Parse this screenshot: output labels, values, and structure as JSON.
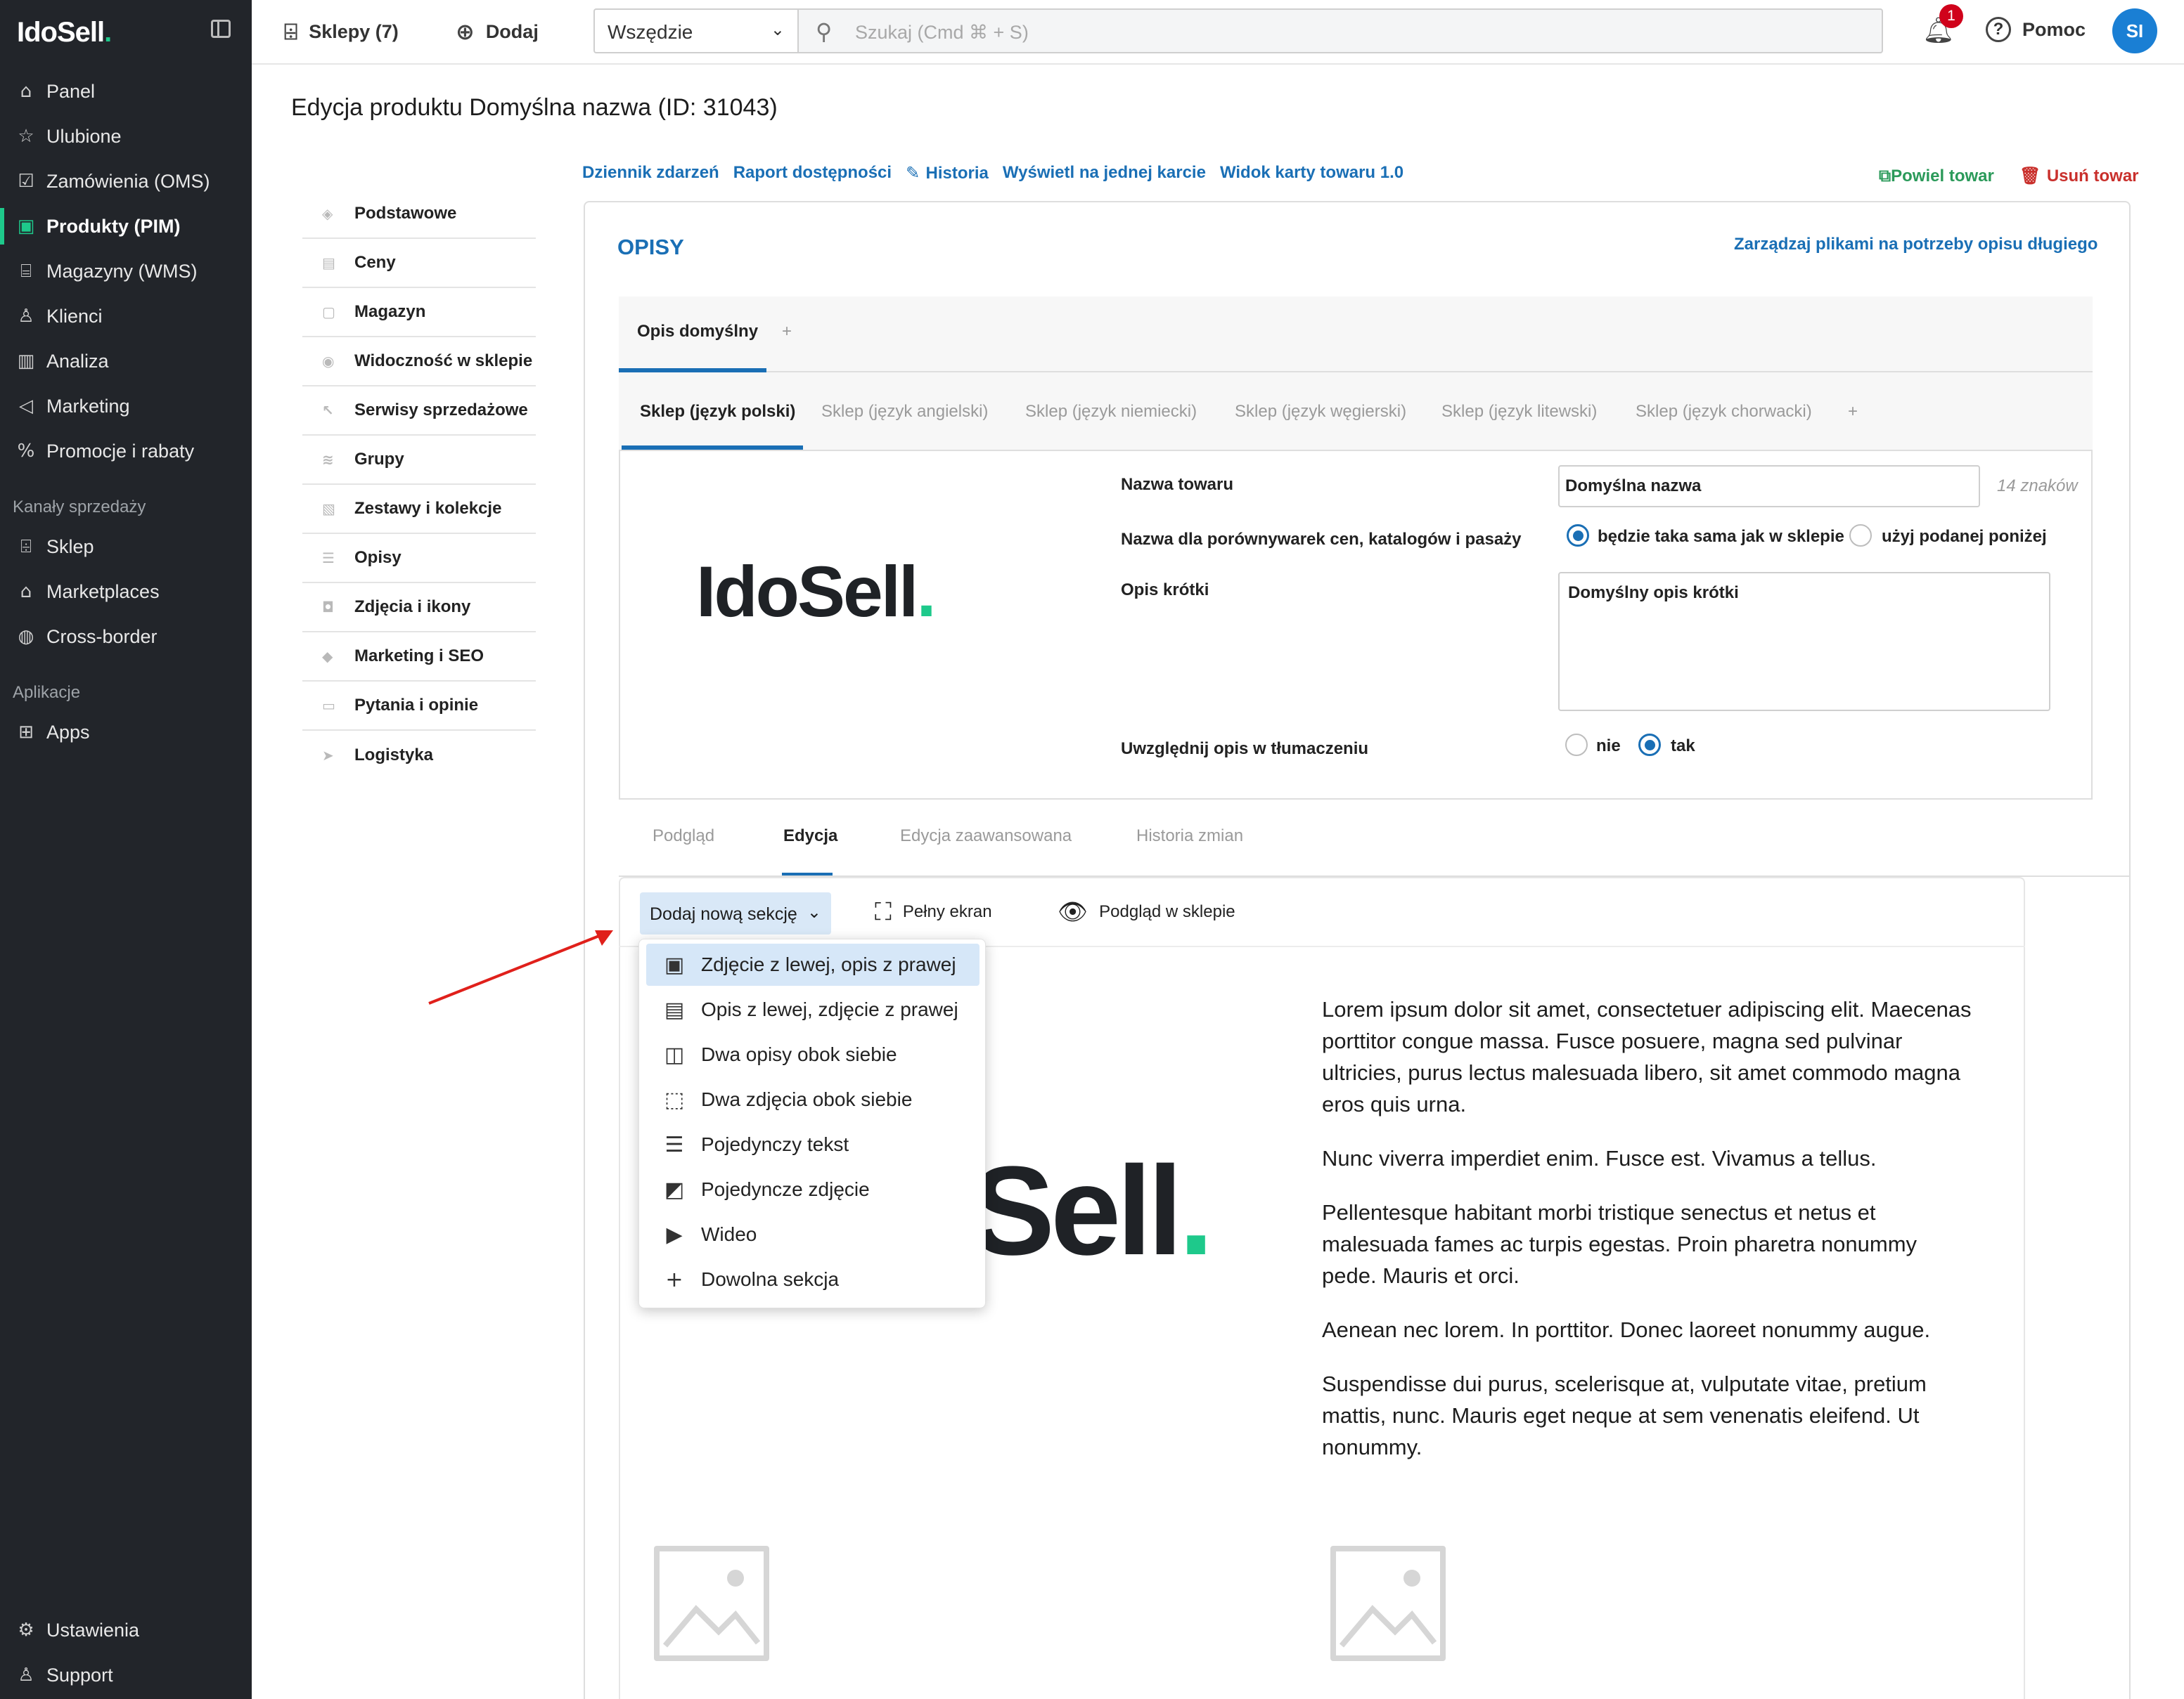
{
  "brand": {
    "logo_text": "IdoSell",
    "logo_dot": "."
  },
  "sidebar": {
    "items": [
      {
        "label": "Panel",
        "icon": "home-icon"
      },
      {
        "label": "Ulubione",
        "icon": "star-icon"
      },
      {
        "label": "Zamówienia (OMS)",
        "icon": "checkbox-icon"
      },
      {
        "label": "Produkty (PIM)",
        "icon": "box-icon",
        "active": true
      },
      {
        "label": "Magazyny (WMS)",
        "icon": "warehouse-icon"
      },
      {
        "label": "Klienci",
        "icon": "users-icon"
      },
      {
        "label": "Analiza",
        "icon": "bar-chart-icon"
      },
      {
        "label": "Marketing",
        "icon": "megaphone-icon"
      },
      {
        "label": "Promocje i rabaty",
        "icon": "percent-icon"
      }
    ],
    "section_channels": "Kanały sprzedaży",
    "channels": [
      {
        "label": "Sklep",
        "icon": "store-icon"
      },
      {
        "label": "Marketplaces",
        "icon": "marketplace-icon"
      },
      {
        "label": "Cross-border",
        "icon": "globe-icon"
      }
    ],
    "section_apps": "Aplikacje",
    "apps": [
      {
        "label": "Apps",
        "icon": "grid-icon"
      }
    ],
    "bottom": [
      {
        "label": "Ustawienia",
        "icon": "gear-icon"
      },
      {
        "label": "Support",
        "icon": "support-icon"
      }
    ]
  },
  "topbar": {
    "shops_label": "Sklepy (7)",
    "add_label": "Dodaj",
    "scope_value": "Wszędzie",
    "search_placeholder": "Szukaj (Cmd ⌘ + S)",
    "notifications_count": "1",
    "help_label": "Pomoc",
    "avatar_initials": "SI"
  },
  "page": {
    "title": "Edycja produktu Domyślna nazwa (ID: 31043)",
    "links": [
      "Dziennik zdarzeń",
      "Raport dostępności",
      "Historia",
      "Wyświetl na jednej karcie",
      "Widok karty towaru 1.0"
    ],
    "duplicate_label": "Powiel towar",
    "delete_label": "Usuń towar"
  },
  "left_nav": [
    "Podstawowe",
    "Ceny",
    "Magazyn",
    "Widoczność w sklepie",
    "Serwisy sprzedażowe",
    "Grupy",
    "Zestawy i kolekcje",
    "Opisy",
    "Zdjęcia i ikony",
    "Marketing i SEO",
    "Pytania i opinie",
    "Logistyka"
  ],
  "opisy": {
    "title": "OPISY",
    "manage_link": "Zarządzaj plikami na potrzeby opisu długiego",
    "desc_tabs": [
      "Opis domyślny",
      "+"
    ],
    "lang_tabs": [
      "Sklep (język polski)",
      "Sklep (język angielski)",
      "Sklep (język niemiecki)",
      "Sklep (język węgierski)",
      "Sklep (język litewski)",
      "Sklep (język chorwacki)",
      "+"
    ],
    "product_name_label": "Nazwa towaru",
    "product_name_value": "Domyślna nazwa",
    "product_name_count": "14 znaków",
    "compare_label": "Nazwa dla porównywarek cen, katalogów i pasaży",
    "compare_opt1": "będzie taka sama jak w sklepie",
    "compare_opt2": "użyj podanej poniżej",
    "short_desc_label": "Opis krótki",
    "short_desc_value": "Domyślny opis krótki",
    "translate_label": "Uwzględnij opis w tłumaczeniu",
    "translate_no": "nie",
    "translate_yes": "tak"
  },
  "editor": {
    "tabs": [
      "Podgląd",
      "Edycja",
      "Edycja zaawansowana",
      "Historia zmian"
    ],
    "add_section_label": "Dodaj nową sekcję",
    "fullscreen_label": "Pełny ekran",
    "preview_shop_label": "Podgląd w sklepie",
    "section_options": [
      {
        "label": "Zdjęcie z lewej, opis z prawej",
        "icon": "image-left-icon"
      },
      {
        "label": "Opis z lewej, zdjęcie z prawej",
        "icon": "image-right-icon"
      },
      {
        "label": "Dwa opisy obok siebie",
        "icon": "two-columns-icon"
      },
      {
        "label": "Dwa zdjęcia obok siebie",
        "icon": "add-image-icon"
      },
      {
        "label": "Pojedynczy tekst",
        "icon": "text-icon"
      },
      {
        "label": "Pojedyncze zdjęcie",
        "icon": "image-icon"
      },
      {
        "label": "Wideo",
        "icon": "video-icon"
      },
      {
        "label": "Dowolna sekcja",
        "icon": "plus-icon"
      }
    ],
    "preview_logo_fragment": "Sell",
    "paragraphs": [
      "Lorem ipsum dolor sit amet, consectetuer adipiscing elit. Maecenas porttitor congue massa. Fusce posuere, magna sed pulvinar ultricies, purus lectus malesuada libero, sit amet commodo magna eros quis urna.",
      "Nunc viverra imperdiet enim. Fusce est. Vivamus a tellus.",
      "Pellentesque habitant morbi tristique senectus et netus et malesuada fames ac turpis egestas. Proin pharetra nonummy pede. Mauris et orci.",
      "Aenean nec lorem. In porttitor. Donec laoreet nonummy augue.",
      "Suspendisse dui purus, scelerisque at, vulputate vitae, pretium mattis, nunc. Mauris eget neque at sem venenatis eleifend. Ut nonummy."
    ]
  },
  "colors": {
    "accent": "#1a6fb5",
    "brand_green": "#1ec98b",
    "sidebar_bg": "#22252a",
    "danger": "#d0021b"
  }
}
